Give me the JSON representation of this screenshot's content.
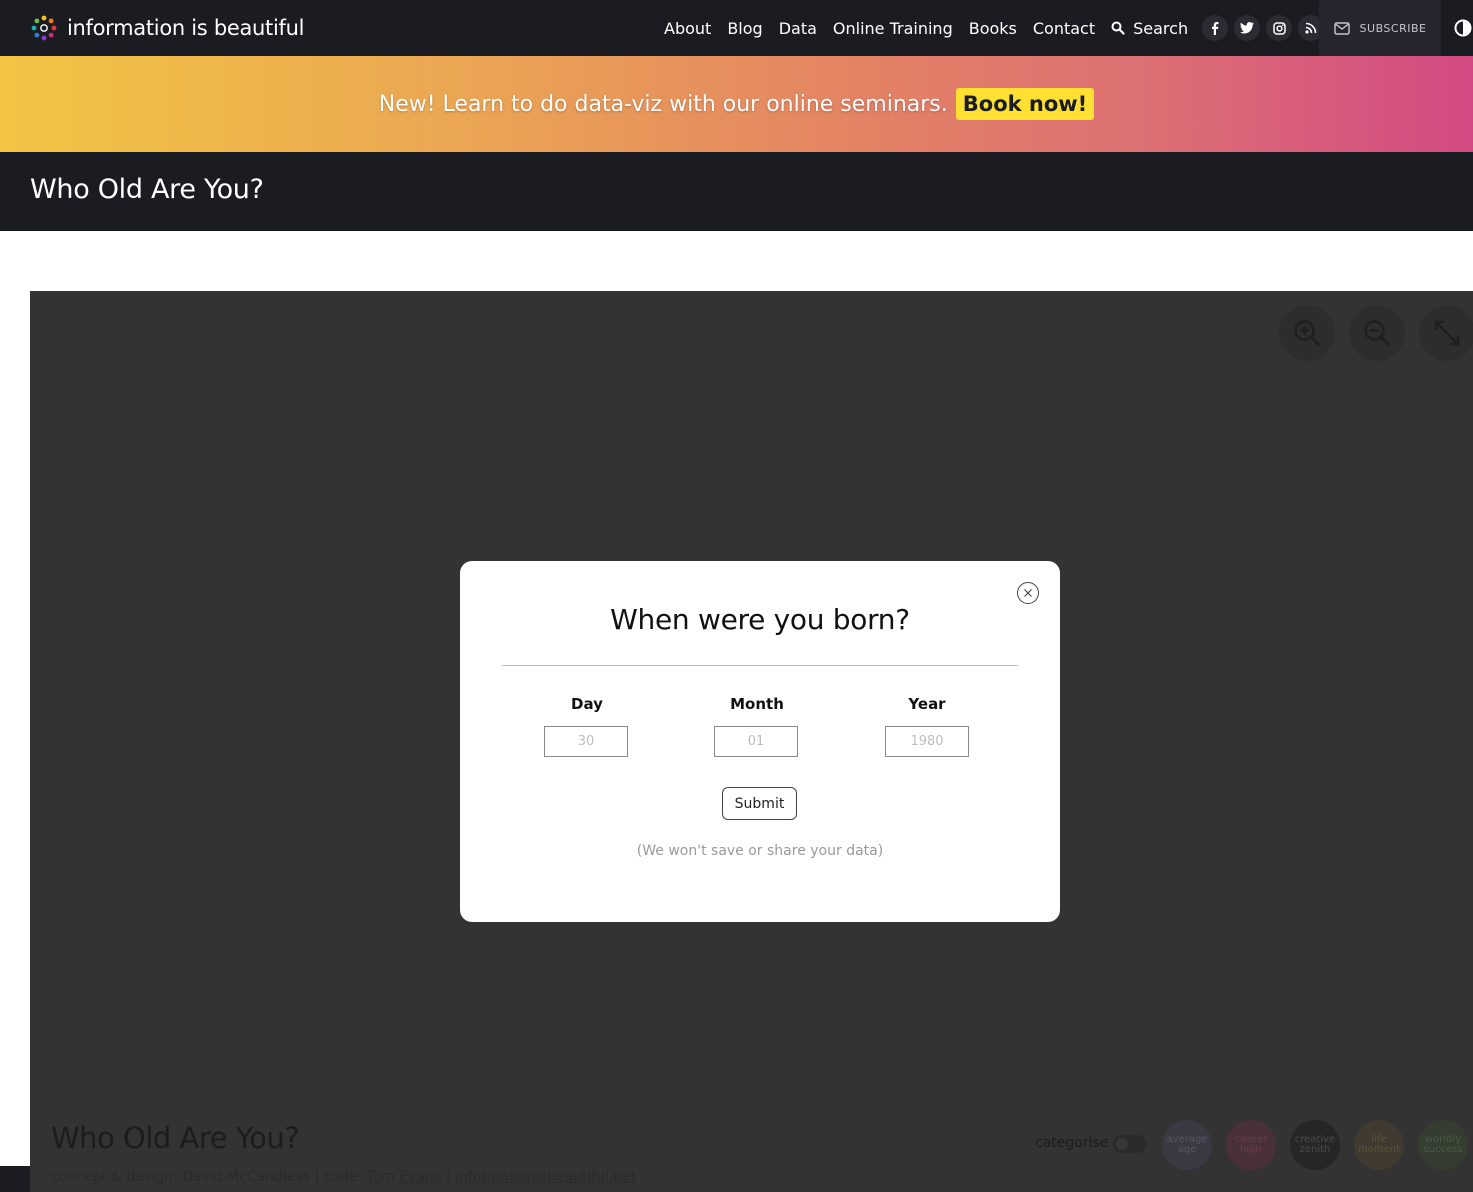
{
  "brand": {
    "logo_text": "information is beautiful"
  },
  "nav": {
    "links": [
      "About",
      "Blog",
      "Data",
      "Online Training",
      "Books",
      "Contact"
    ],
    "search_label": "Search",
    "social_icons": [
      "facebook-icon",
      "twitter-icon",
      "instagram-icon",
      "rss-icon"
    ],
    "subscribe_label": "SUBSCRIBE"
  },
  "banner": {
    "text": "New! Learn to do data-viz with our online seminars.",
    "button_label": "Book now!"
  },
  "page": {
    "title": "Who Old Are You?"
  },
  "viz": {
    "title": "Who Old Are You?",
    "credits": {
      "prefix": "concept & design: David McCandless | code: ",
      "coder": "Tom Evans",
      "separator": " | ",
      "site": "informationisbeautiful.net"
    },
    "categorise_label": "categorise",
    "categories": [
      {
        "label": "average age",
        "color": "#3a3a44",
        "text_color": "#555562"
      },
      {
        "label": "career high",
        "color": "#4a3038",
        "text_color": "#6b3d4a"
      },
      {
        "label": "creative zenith",
        "color": "#262626",
        "text_color": "#4a4a4a"
      },
      {
        "label": "life moment",
        "color": "#403a30",
        "text_color": "#5e5238"
      },
      {
        "label": "worldly success",
        "color": "#343d30",
        "text_color": "#4c5a44"
      }
    ]
  },
  "modal": {
    "title": "When were you born?",
    "fields": [
      {
        "label": "Day",
        "placeholder": "30"
      },
      {
        "label": "Month",
        "placeholder": "01"
      },
      {
        "label": "Year",
        "placeholder": "1980"
      }
    ],
    "submit_label": "Submit",
    "privacy_note": "(We won't save or share your data)"
  }
}
